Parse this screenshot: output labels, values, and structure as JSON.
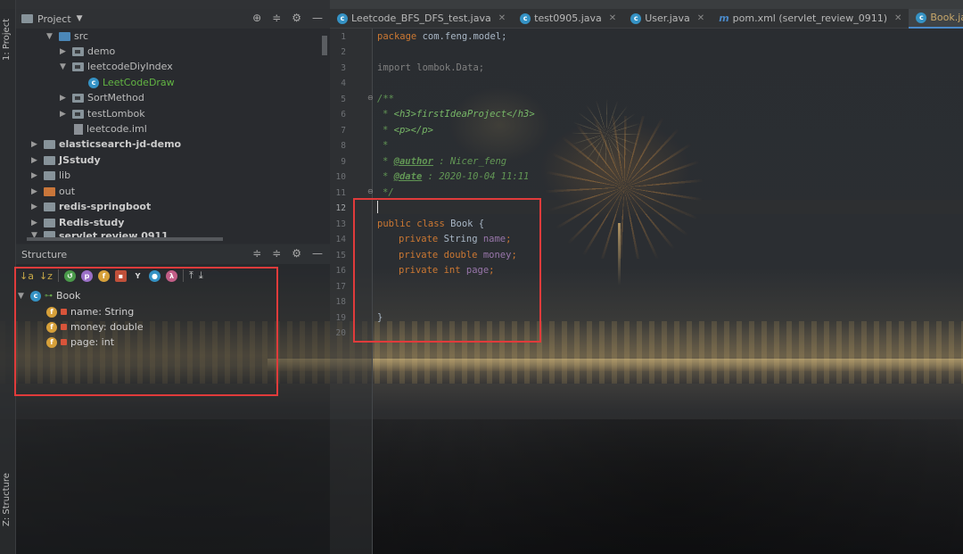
{
  "colors": {
    "accent": "#4a88c7",
    "highlight_box": "#e03b3b",
    "keyword": "#cc7832",
    "comment": "#629755"
  },
  "side_tabs": {
    "project": "1: Project",
    "structure": "Z: Structure"
  },
  "project_panel": {
    "title": "Project",
    "tree": [
      {
        "label": "src",
        "icon": "folder-blue-icon"
      },
      {
        "label": "demo",
        "icon": "package-icon"
      },
      {
        "label": "leetcodeDiyIndex",
        "icon": "package-icon"
      },
      {
        "label": "LeetCodeDraw",
        "icon": "class-icon"
      },
      {
        "label": "SortMethod",
        "icon": "package-icon"
      },
      {
        "label": "testLombok",
        "icon": "package-icon"
      },
      {
        "label": "leetcode.iml",
        "icon": "file-icon"
      },
      {
        "label": "elasticsearch-jd-demo",
        "icon": "folder-icon"
      },
      {
        "label": "JSstudy",
        "icon": "folder-icon"
      },
      {
        "label": "lib",
        "icon": "folder-icon"
      },
      {
        "label": "out",
        "icon": "folder-orange-icon"
      },
      {
        "label": "redis-springboot",
        "icon": "folder-icon"
      },
      {
        "label": "Redis-study",
        "icon": "folder-icon"
      },
      {
        "label": "servlet review 0911",
        "icon": "folder-icon"
      }
    ]
  },
  "structure_panel": {
    "title": "Structure",
    "class_name": "Book",
    "members": [
      {
        "label": "name: String"
      },
      {
        "label": "money: double"
      },
      {
        "label": "page: int"
      }
    ]
  },
  "tabs": [
    {
      "label": "Leetcode_BFS_DFS_test.java",
      "icon": "class-icon"
    },
    {
      "label": "test0905.java",
      "icon": "class-icon"
    },
    {
      "label": "User.java",
      "icon": "class-icon"
    },
    {
      "label": "pom.xml (servlet_review_0911)",
      "icon": "maven-icon"
    },
    {
      "label": "Book.java",
      "icon": "class-icon",
      "active": true
    }
  ],
  "editor": {
    "line_numbers": [
      "1",
      "2",
      "3",
      "4",
      "5",
      "6",
      "7",
      "8",
      "9",
      "10",
      "11",
      "12",
      "13",
      "14",
      "15",
      "16",
      "17",
      "18",
      "19",
      "20"
    ],
    "package_kw": "package",
    "package_name": " com.feng.model;",
    "import_kw": "import",
    "import_name": " lombok.Data;",
    "doc_open": "/**",
    "doc_h3": "<h3>firstIdeaProject</h3>",
    "doc_p": "<p></p>",
    "doc_star": "*",
    "author_tag": "@author",
    "author_val": " : Nicer_feng",
    "date_tag": "@date",
    "date_val": " : 2020-10-04 11:11",
    "doc_close": "*/",
    "class_kw": "public class",
    "class_name": " Book {",
    "field1_kw": "private",
    "field1_type": " String ",
    "field1_name": "name",
    "field1_end": ";",
    "field2_kw": "private double",
    "field2_name": " money",
    "field2_end": ";",
    "field3_kw": "private int",
    "field3_name": " page",
    "field3_end": ";",
    "close_brace": "}"
  }
}
